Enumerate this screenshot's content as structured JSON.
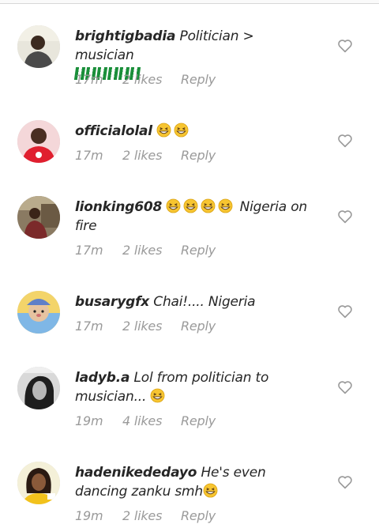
{
  "comments": [
    {
      "username": "brightigbadia",
      "text": "Politician > musician",
      "flags": 6,
      "emoji_count": 0,
      "time": "17m",
      "likes": "2 likes",
      "reply": "Reply"
    },
    {
      "username": "officialolal",
      "text": "",
      "emoji_count": 2,
      "time": "17m",
      "likes": "2 likes",
      "reply": "Reply"
    },
    {
      "username": "lionking608",
      "text": "Nigeria on fire",
      "emoji_count": 4,
      "time": "17m",
      "likes": "2 likes",
      "reply": "Reply"
    },
    {
      "username": "busarygfx",
      "text": "Chai!.... Nigeria",
      "emoji_count": 0,
      "time": "17m",
      "likes": "2 likes",
      "reply": "Reply"
    },
    {
      "username": "ladyb.a",
      "text": "Lol from politician to musician...",
      "emoji_count": 1,
      "time": "19m",
      "likes": "4 likes",
      "reply": "Reply"
    },
    {
      "username": "hadenikededayo",
      "text": "He's even dancing zanku smh",
      "emoji_count": 1,
      "time": "19m",
      "likes": "2 likes",
      "reply": "Reply"
    }
  ],
  "icons": {
    "like": "heart-outline-icon",
    "emoji": "grinning-squinting-face-emoji",
    "flag": "nigeria-flag-emoji"
  },
  "colors": {
    "text": "#262626",
    "meta": "#9a9a9a",
    "heart": "#9a9a9a",
    "emoji": "#f7c531",
    "flag_green": "#1a8f3a"
  }
}
